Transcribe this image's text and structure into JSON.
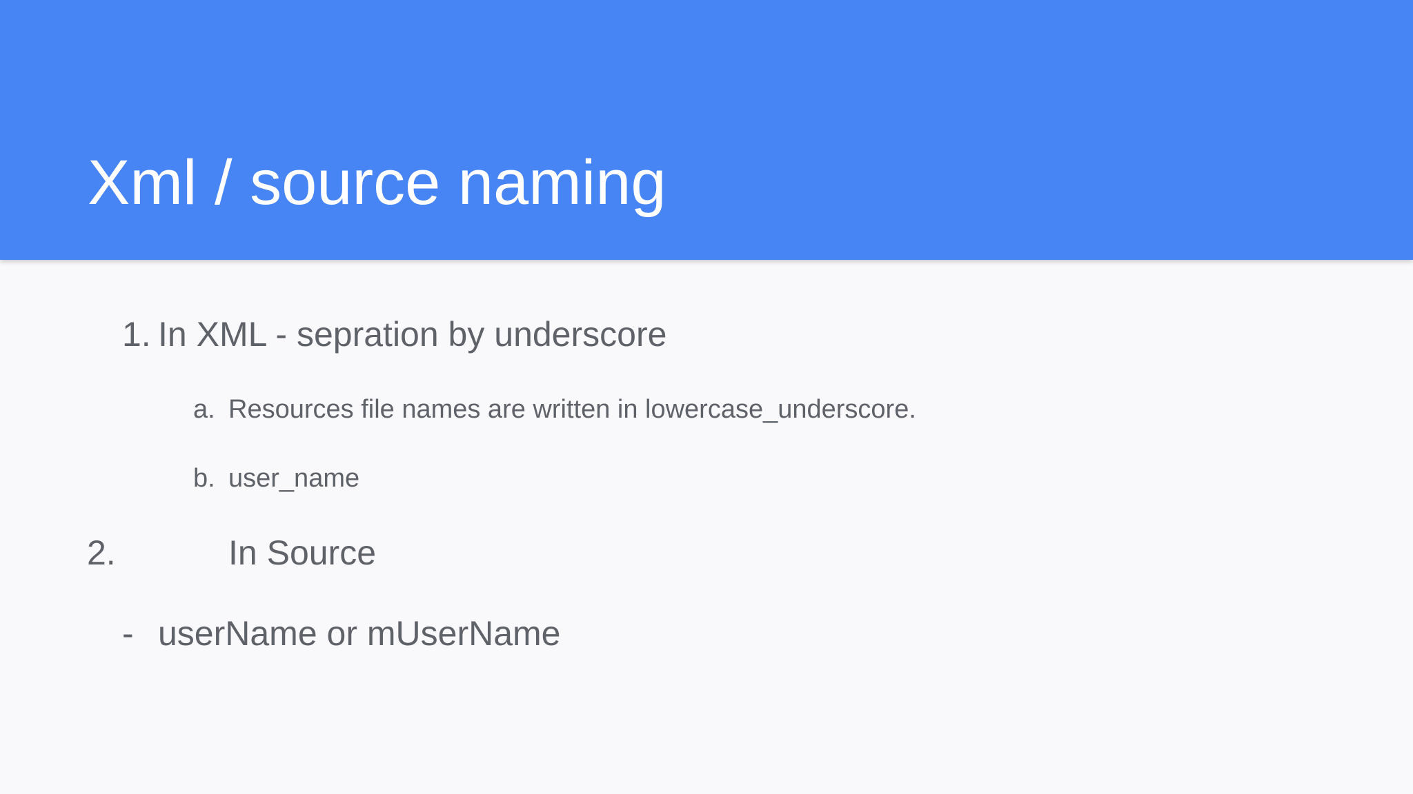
{
  "slide": {
    "title": "Xml / source naming",
    "items": [
      {
        "marker": "1.",
        "text": "In XML - sepration by underscore"
      },
      {
        "marker": "a.",
        "text": "Resources file names are written in lowercase_underscore."
      },
      {
        "marker": "b.",
        "text": "user_name"
      },
      {
        "marker": "2.",
        "text": "In Source"
      },
      {
        "marker": "-",
        "text": "userName or mUserName"
      }
    ]
  },
  "colors": {
    "header": "#4785f4",
    "background": "#f9f8fb",
    "title": "#ffffff",
    "body_text": "#5f6269"
  }
}
